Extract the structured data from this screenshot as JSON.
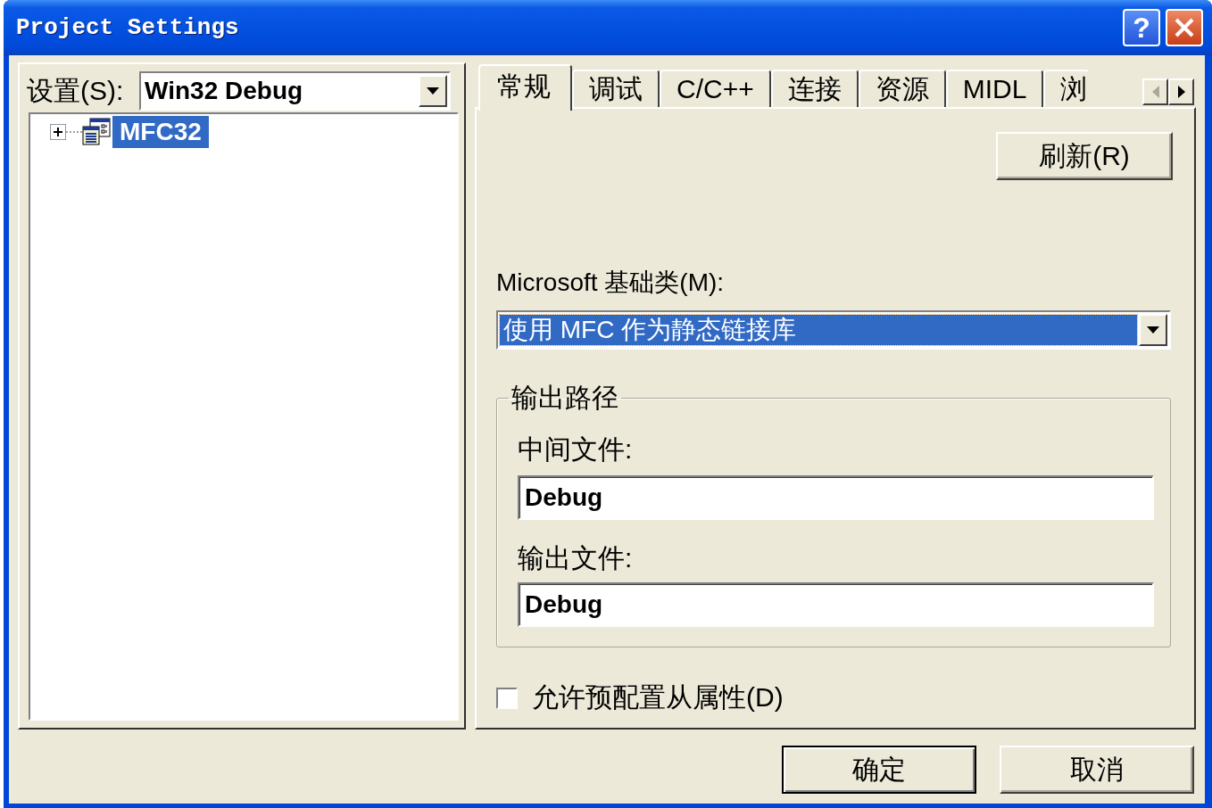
{
  "window": {
    "title": "Project Settings",
    "help_button": "?"
  },
  "settings": {
    "label": "设置(S):",
    "configuration": "Win32 Debug",
    "tree": [
      {
        "label": "MFC32",
        "expanded": false,
        "selected": true
      }
    ]
  },
  "tabs": [
    {
      "label": "常规",
      "selected": true
    },
    {
      "label": "调试",
      "selected": false
    },
    {
      "label": "C/C++",
      "selected": false
    },
    {
      "label": "连接",
      "selected": false
    },
    {
      "label": "资源",
      "selected": false
    },
    {
      "label": "MIDL",
      "selected": false
    },
    {
      "label": "浏",
      "selected": false
    }
  ],
  "tab_scroll": {
    "back_disabled": true,
    "forward_disabled": false
  },
  "general": {
    "refresh_button": "刷新(R)",
    "framework_label": "Microsoft 基础类(M):",
    "framework": {
      "value": "使用 MFC 作为静态链接库",
      "focused": true
    },
    "output_group": {
      "title": "输出路径",
      "fields": [
        {
          "label": "中间文件:",
          "value": "Debug"
        },
        {
          "label": "输出文件:",
          "value": "Debug"
        }
      ]
    },
    "allow_dependencies": {
      "label": "允许预配置从属性(D)",
      "checked": false
    }
  },
  "buttons": [
    {
      "label": "确定",
      "default": true
    },
    {
      "label": "取消",
      "default": false
    }
  ]
}
